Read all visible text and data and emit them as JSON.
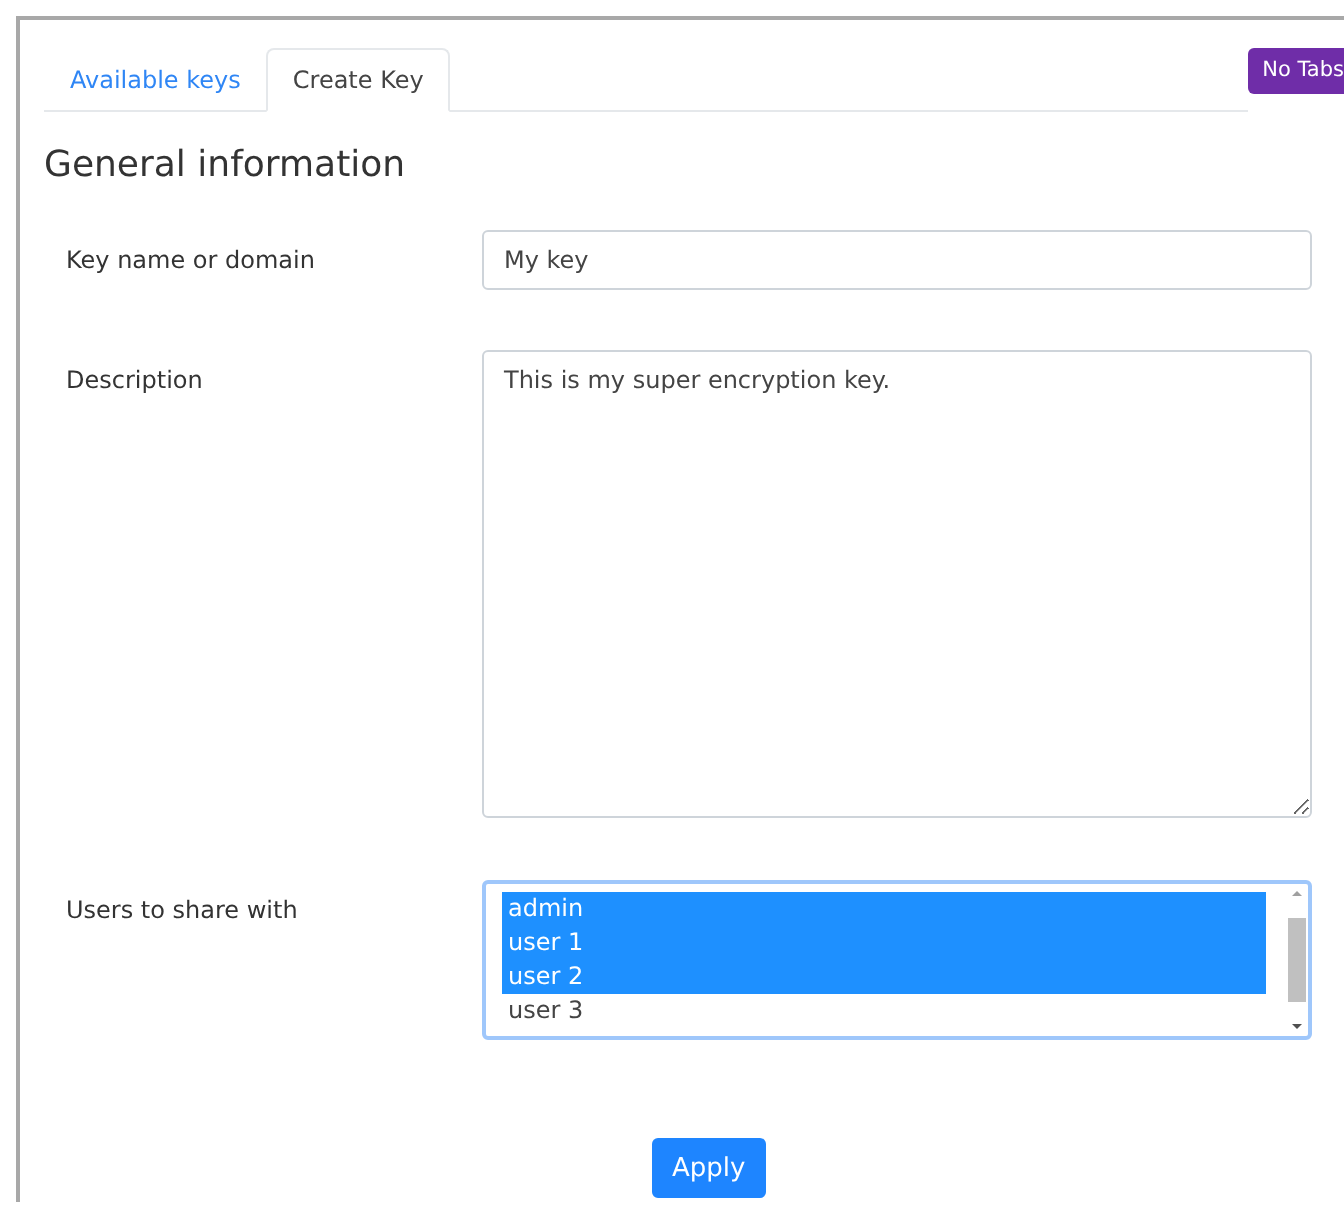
{
  "tabs": [
    {
      "label": "Available keys",
      "selected": false
    },
    {
      "label": "Create Key",
      "selected": true
    }
  ],
  "badge": "No Tabs",
  "heading": "General information",
  "form": {
    "key_name": {
      "label": "Key name or domain",
      "value": "My key"
    },
    "description": {
      "label": "Description",
      "value": "This is my super encryption key."
    },
    "users": {
      "label": "Users to share with",
      "options": [
        {
          "label": "admin",
          "selected": true
        },
        {
          "label": "user 1",
          "selected": true
        },
        {
          "label": "user 2",
          "selected": true
        },
        {
          "label": "user 3",
          "selected": false
        }
      ]
    }
  },
  "apply_button": "Apply"
}
